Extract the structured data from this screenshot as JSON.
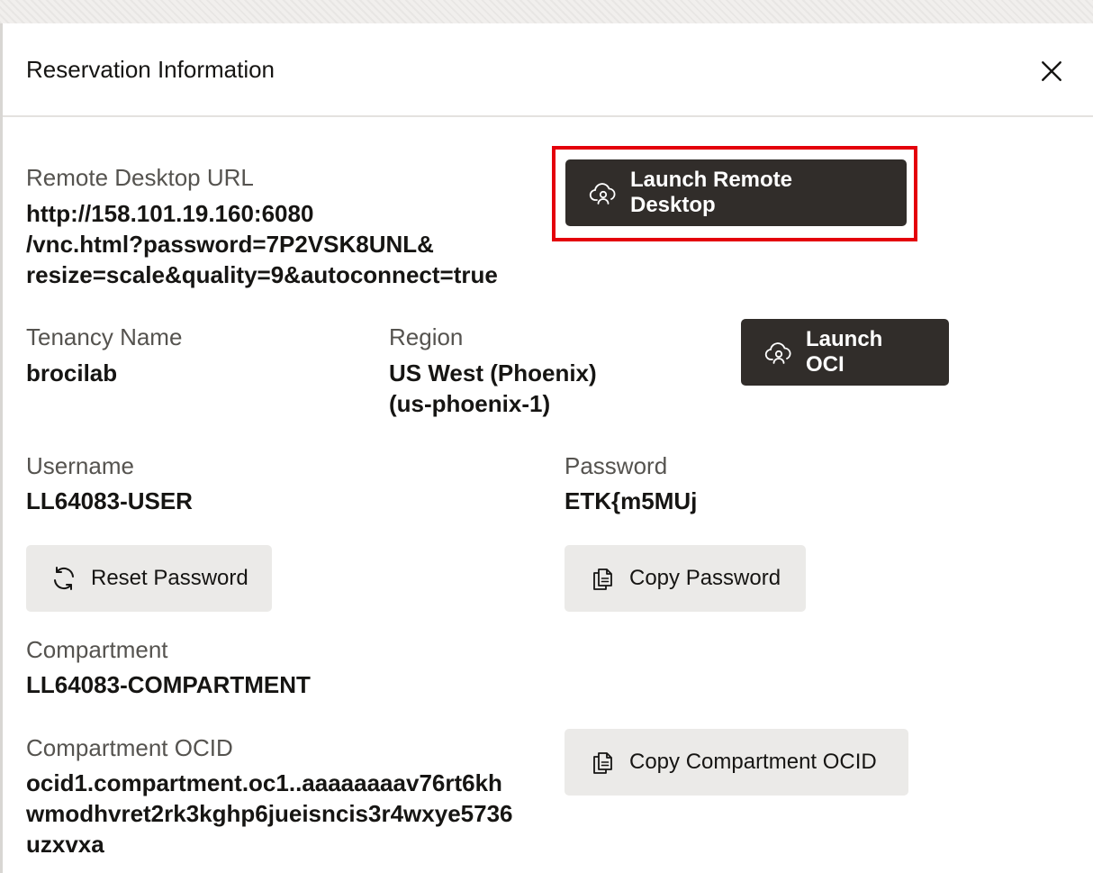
{
  "dialog": {
    "title": "Reservation Information"
  },
  "remote_desktop": {
    "label": "Remote Desktop URL",
    "url_lines": [
      "http://158.101.19.160:6080",
      "/vnc.html?password=7P2VSK8UNL&",
      "resize=scale&quality=9&autoconnect=true"
    ],
    "launch_label": "Launch Remote Desktop"
  },
  "tenancy": {
    "label": "Tenancy Name",
    "value": "brocilab"
  },
  "region": {
    "label": "Region",
    "value_lines": [
      "US West (Phoenix)",
      "(us-phoenix-1)"
    ],
    "launch_label": "Launch OCI"
  },
  "username": {
    "label": "Username",
    "value": "LL64083-USER"
  },
  "password": {
    "label": "Password",
    "value": "ETK{m5MUj"
  },
  "buttons": {
    "reset_password": "Reset Password",
    "copy_password": "Copy Password",
    "copy_compartment_ocid": "Copy Compartment OCID"
  },
  "compartment": {
    "label": "Compartment",
    "value": "LL64083-COMPARTMENT"
  },
  "compartment_ocid": {
    "label": "Compartment OCID",
    "value_lines": [
      "ocid1.compartment.oc1..aaaaaaaav76rt6kh",
      "wmodhvret2rk3kghp6jueisncis3r4wxye5736",
      "uzxvxa"
    ]
  },
  "icons": {
    "close": "close-icon",
    "cloud_user": "cloud-user-icon",
    "refresh": "refresh-icon",
    "copy": "copy-icon"
  },
  "colors": {
    "primary_button": "#312d2a",
    "secondary_button": "#ebeae8",
    "highlight": "#e4000b",
    "label_text": "#55534f"
  }
}
